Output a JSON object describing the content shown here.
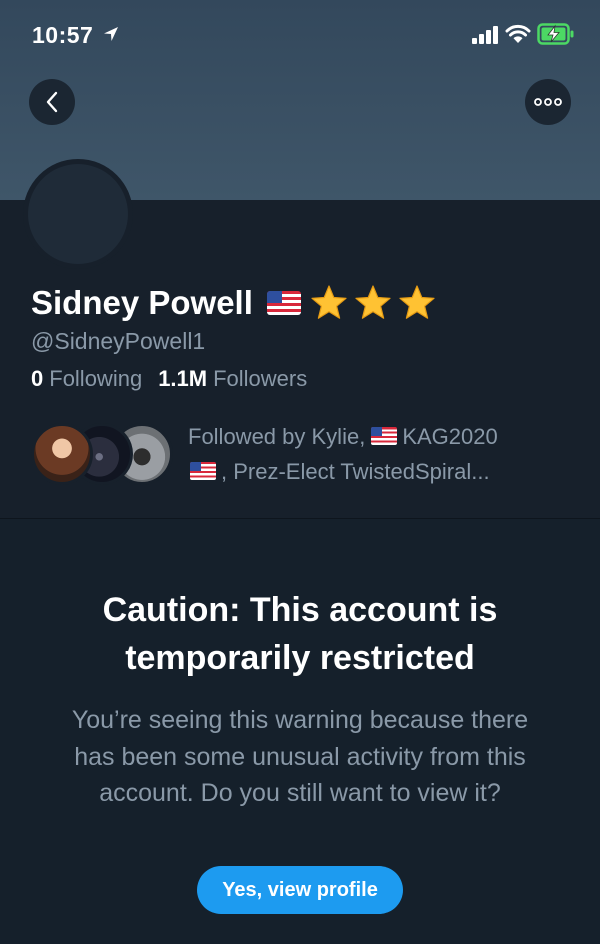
{
  "status_bar": {
    "time": "10:57",
    "icons": [
      "location-arrow-icon",
      "signal-icon",
      "wifi-icon",
      "battery-charging-icon"
    ]
  },
  "header": {
    "back_icon": "chevron-left-icon",
    "more_icon": "more-horizontal-icon"
  },
  "profile": {
    "name": "Sidney Powell",
    "name_emoji": [
      "us-flag",
      "star",
      "star",
      "star"
    ],
    "handle": "@SidneyPowell1",
    "following_count": "0",
    "following_label": "Following",
    "followers_count": "1.1M",
    "followers_label": "Followers",
    "followed_by": {
      "prefix": "Followed by Kylie,",
      "second": "KAG2020",
      "line2": ", Prez-Elect TwistedSpiral..."
    }
  },
  "warning": {
    "title": "Caution: This account is temporarily restricted",
    "body": "You’re seeing this warning because there has been some unusual activity from this account. Do you still want to view it?",
    "button_label": "Yes, view profile"
  },
  "colors": {
    "background": "#15202b",
    "banner": "#3a5063",
    "muted_text": "#8a99a8",
    "accent": "#1d9bf0",
    "star": "#ffc233"
  }
}
